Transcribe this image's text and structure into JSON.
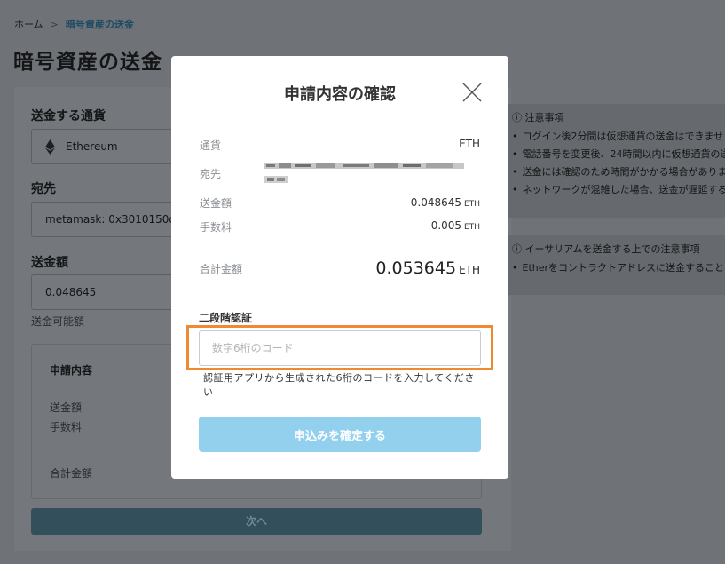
{
  "breadcrumb": {
    "home": "ホーム",
    "separator": ">",
    "current": "暗号資産の送金"
  },
  "page": {
    "title": "暗号資産の送金"
  },
  "form": {
    "currency_label": "送金する通貨",
    "currency_value": "Ethereum",
    "destination_label": "宛先",
    "destination_value": "metamask: 0x3010150dc",
    "amount_label": "送金額",
    "amount_value": "0.048645",
    "available_label": "送金可能額",
    "summary": {
      "title": "申請内容",
      "amount_label": "送金額",
      "fee_label": "手数料",
      "total_label": "合計金額"
    },
    "next_button": "次へ"
  },
  "notices": {
    "first": {
      "title": "注意事項",
      "items": [
        "ログイン後2分間は仮想通貨の送金はできませ",
        "電話番号を変更後、24時間以内に仮想通貨の送",
        "送金には確認のため時間がかかる場合がありま",
        "ネットワークが混雑した場合、送金が遅延する"
      ]
    },
    "second": {
      "title": "イーサリアムを送金する上での注意事項",
      "items": [
        "Etherをコントラクトアドレスに送金すること"
      ]
    }
  },
  "modal": {
    "title": "申請内容の確認",
    "rows": {
      "currency": {
        "label": "通貨",
        "value": "ETH"
      },
      "destination": {
        "label": "宛先"
      },
      "amount": {
        "label": "送金額",
        "value": "0.048645",
        "unit": "ETH"
      },
      "fee": {
        "label": "手数料",
        "value": "0.005",
        "unit": "ETH"
      },
      "total": {
        "label": "合計金額",
        "value": "0.053645",
        "unit": "ETH"
      }
    },
    "twofa": {
      "label": "二段階認証",
      "placeholder": "数字6桁のコード",
      "value": "",
      "hint": "認証用アプリから生成された6桁のコードを入力してください"
    },
    "confirm_button": "申込みを確定する"
  },
  "colors": {
    "highlight": "#ee8a2f",
    "confirm_button": "#92d0ee",
    "accent": "#1d4a63"
  }
}
